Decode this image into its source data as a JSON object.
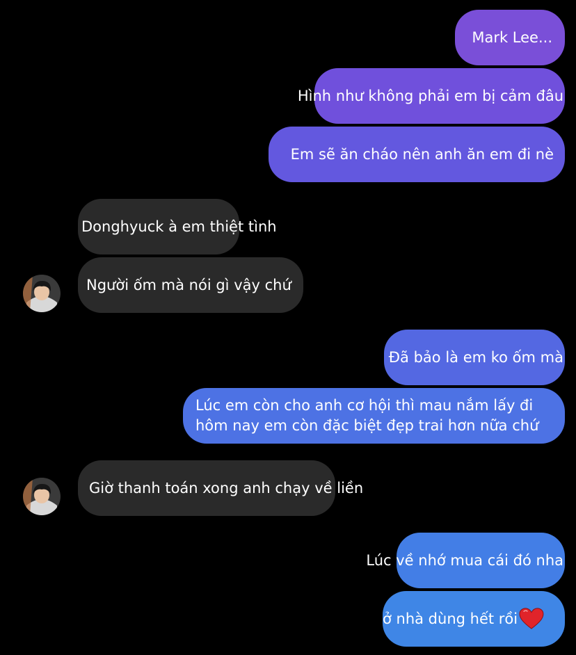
{
  "conversation": {
    "messages": [
      {
        "id": "m1",
        "side": "sent",
        "text": "Mark Lee..."
      },
      {
        "id": "m2",
        "side": "sent",
        "text": "Hình như không phải em bị cảm đâu"
      },
      {
        "id": "m3",
        "side": "sent",
        "text": "Em sẽ ăn cháo nên anh ăn em đi nè"
      },
      {
        "id": "m4",
        "side": "received",
        "text": "Donghyuck à em thiệt tình"
      },
      {
        "id": "m5",
        "side": "received",
        "text": "Người ốm mà nói gì vậy chứ"
      },
      {
        "id": "m6",
        "side": "sent",
        "text": "Đã bảo là em ko ốm mà"
      },
      {
        "id": "m7",
        "side": "sent",
        "lines": [
          "Lúc em còn cho anh cơ hội thì mau nắm lấy đi",
          "hôm nay em còn đặc biệt đẹp trai hơn nữa chứ"
        ]
      },
      {
        "id": "m8",
        "side": "received",
        "text": "Giờ thanh toán xong anh chạy về liền"
      },
      {
        "id": "m9",
        "side": "sent",
        "text": "Lúc về nhớ mua cái đó nha"
      },
      {
        "id": "m10",
        "side": "sent",
        "text": "ở nhà dùng hết rồi",
        "emoji": "heart-icon"
      }
    ]
  },
  "colors": {
    "background": "#000000",
    "sent_top": "#7a4fd8",
    "sent_bottom": "#3f86e6",
    "received": "#2a2a2a",
    "heart": "#e0242a"
  }
}
